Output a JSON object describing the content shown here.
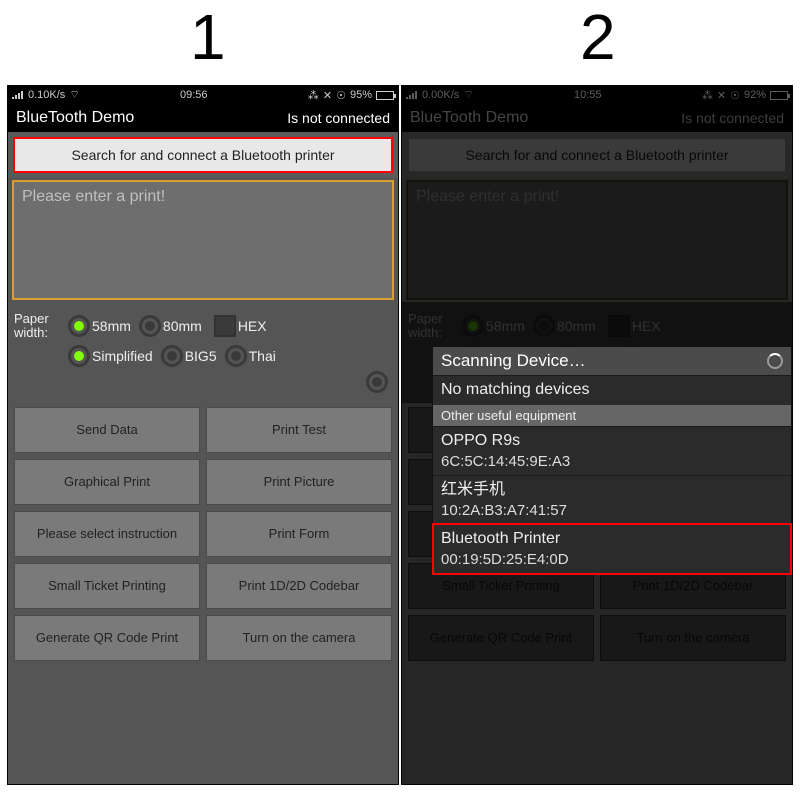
{
  "step_labels": {
    "one": "1",
    "two": "2"
  },
  "status_bar": {
    "rate1": "0.10K/s",
    "rate2": "0.00K/s",
    "time1": "09:56",
    "time2": "10:55",
    "batt1": "95%",
    "batt2": "92%"
  },
  "titlebar": {
    "title": "BlueTooth Demo",
    "connected": "Is not connected"
  },
  "search_button": "Search for and connect a Bluetooth printer",
  "print_area_placeholder": "Please enter a print!",
  "paper": {
    "label": "Paper width:",
    "opt1": "58mm",
    "opt2": "80mm",
    "hex": "HEX",
    "enc1": "Simplified",
    "enc2": "BIG5",
    "enc3": "Thai"
  },
  "buttons": {
    "send": "Send Data",
    "test": "Print Test",
    "graph": "Graphical Print",
    "pic": "Print Picture",
    "instr": "Please select instruction",
    "form": "Print Form",
    "ticket": "Small Ticket Printing",
    "codebar": "Print 1D/2D Codebar",
    "qr": "Generate QR Code Print",
    "camera": "Turn on the camera"
  },
  "popup": {
    "title": "Scanning Device…",
    "no_match": "No matching devices",
    "other": "Other useful equipment",
    "devices": [
      {
        "name": "OPPO R9s",
        "mac": "6C:5C:14:45:9E:A3"
      },
      {
        "name": "红米手机",
        "mac": "10:2A:B3:A7:41:57"
      },
      {
        "name": "Bluetooth Printer",
        "mac": "00:19:5D:25:E4:0D"
      }
    ]
  }
}
